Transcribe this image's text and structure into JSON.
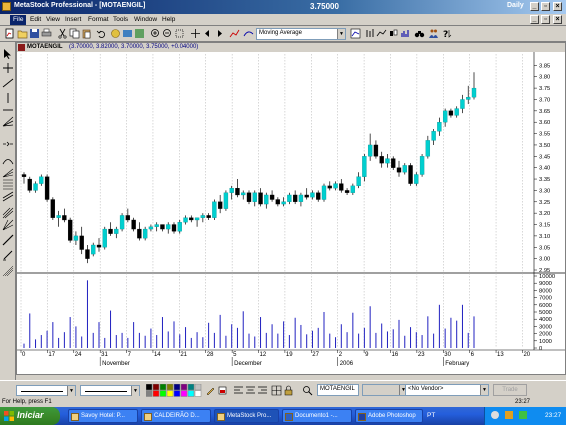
{
  "window": {
    "app_title": "MetaStock Professional - [MOTAENGIL]",
    "center_value": "3.75000",
    "periodicity": "Daily"
  },
  "menu": [
    "File",
    "Edit",
    "View",
    "Insert",
    "Format",
    "Tools",
    "Window",
    "Help"
  ],
  "toolbar": {
    "indicator_select": "Moving Average"
  },
  "chart_header": {
    "symbol": "MOTAENGIL",
    "values": "(3.70000, 3.82000, 3.70000, 3.75000, +0.04000)"
  },
  "chart_data": {
    "type": "candlestick",
    "title": "MOTAENGIL",
    "price_axis": {
      "range": [
        2.95,
        3.9
      ],
      "ticks": [
        "3.85",
        "3.80",
        "3.75",
        "3.70",
        "3.65",
        "3.60",
        "3.55",
        "3.50",
        "3.45",
        "3.40",
        "3.35",
        "3.30",
        "3.25",
        "3.20",
        "3.15",
        "3.10",
        "3.05",
        "3.00",
        "2.95"
      ]
    },
    "volume_axis": {
      "range": [
        0,
        10000
      ],
      "ticks": [
        "10000",
        "9000",
        "8000",
        "7000",
        "6000",
        "5000",
        "4000",
        "3000",
        "2000",
        "1000",
        "0"
      ]
    },
    "x_ticks": [
      "0",
      "17",
      "24",
      "31",
      "7",
      "14",
      "21",
      "28",
      "5",
      "12",
      "19",
      "27",
      "2",
      "9",
      "16",
      "23",
      "30",
      "6",
      "13",
      "20"
    ],
    "month_labels": [
      "November",
      "December",
      "2006",
      "February"
    ],
    "candles": [
      [
        3.37,
        3.38,
        3.33,
        3.36
      ],
      [
        3.35,
        3.36,
        3.29,
        3.3
      ],
      [
        3.3,
        3.34,
        3.29,
        3.33
      ],
      [
        3.33,
        3.37,
        3.32,
        3.36
      ],
      [
        3.36,
        3.37,
        3.25,
        3.26
      ],
      [
        3.26,
        3.27,
        3.17,
        3.18
      ],
      [
        3.18,
        3.21,
        3.14,
        3.19
      ],
      [
        3.19,
        3.22,
        3.16,
        3.17
      ],
      [
        3.17,
        3.18,
        3.07,
        3.08
      ],
      [
        3.08,
        3.12,
        3.06,
        3.1
      ],
      [
        3.1,
        3.14,
        3.02,
        3.04
      ],
      [
        3.04,
        3.06,
        2.98,
        3.0
      ],
      [
        3.02,
        3.07,
        3.01,
        3.06
      ],
      [
        3.06,
        3.09,
        3.03,
        3.05
      ],
      [
        3.05,
        3.14,
        3.04,
        3.13
      ],
      [
        3.13,
        3.16,
        3.1,
        3.11
      ],
      [
        3.11,
        3.14,
        3.09,
        3.13
      ],
      [
        3.13,
        3.2,
        3.12,
        3.19
      ],
      [
        3.19,
        3.22,
        3.16,
        3.17
      ],
      [
        3.17,
        3.18,
        3.12,
        3.13
      ],
      [
        3.13,
        3.16,
        3.08,
        3.09
      ],
      [
        3.09,
        3.14,
        3.08,
        3.13
      ],
      [
        3.13,
        3.15,
        3.12,
        3.14
      ],
      [
        3.14,
        3.16,
        3.12,
        3.15
      ],
      [
        3.15,
        3.15,
        3.12,
        3.13
      ],
      [
        3.13,
        3.16,
        3.11,
        3.15
      ],
      [
        3.15,
        3.16,
        3.11,
        3.12
      ],
      [
        3.12,
        3.17,
        3.11,
        3.16
      ],
      [
        3.16,
        3.19,
        3.15,
        3.18
      ],
      [
        3.18,
        3.19,
        3.16,
        3.17
      ],
      [
        3.17,
        3.18,
        3.14,
        3.18
      ],
      [
        3.18,
        3.2,
        3.16,
        3.19
      ],
      [
        3.19,
        3.2,
        3.17,
        3.18
      ],
      [
        3.18,
        3.26,
        3.17,
        3.25
      ],
      [
        3.25,
        3.28,
        3.2,
        3.22
      ],
      [
        3.22,
        3.3,
        3.21,
        3.29
      ],
      [
        3.29,
        3.32,
        3.26,
        3.31
      ],
      [
        3.31,
        3.35,
        3.27,
        3.28
      ],
      [
        3.28,
        3.3,
        3.26,
        3.29
      ],
      [
        3.29,
        3.3,
        3.24,
        3.25
      ],
      [
        3.25,
        3.3,
        3.23,
        3.29
      ],
      [
        3.29,
        3.31,
        3.23,
        3.24
      ],
      [
        3.24,
        3.29,
        3.22,
        3.28
      ],
      [
        3.28,
        3.3,
        3.25,
        3.26
      ],
      [
        3.26,
        3.27,
        3.23,
        3.24
      ],
      [
        3.24,
        3.27,
        3.23,
        3.25
      ],
      [
        3.25,
        3.29,
        3.24,
        3.28
      ],
      [
        3.28,
        3.3,
        3.24,
        3.25
      ],
      [
        3.25,
        3.29,
        3.23,
        3.28
      ],
      [
        3.28,
        3.31,
        3.26,
        3.27
      ],
      [
        3.27,
        3.3,
        3.26,
        3.29
      ],
      [
        3.29,
        3.3,
        3.25,
        3.26
      ],
      [
        3.26,
        3.33,
        3.25,
        3.32
      ],
      [
        3.32,
        3.34,
        3.3,
        3.31
      ],
      [
        3.31,
        3.34,
        3.3,
        3.33
      ],
      [
        3.33,
        3.35,
        3.29,
        3.3
      ],
      [
        3.3,
        3.31,
        3.28,
        3.29
      ],
      [
        3.29,
        3.33,
        3.28,
        3.32
      ],
      [
        3.32,
        3.38,
        3.31,
        3.36
      ],
      [
        3.36,
        3.46,
        3.34,
        3.45
      ],
      [
        3.45,
        3.55,
        3.43,
        3.5
      ],
      [
        3.5,
        3.52,
        3.44,
        3.45
      ],
      [
        3.45,
        3.47,
        3.4,
        3.42
      ],
      [
        3.42,
        3.46,
        3.4,
        3.44
      ],
      [
        3.44,
        3.45,
        3.39,
        3.4
      ],
      [
        3.4,
        3.43,
        3.36,
        3.38
      ],
      [
        3.38,
        3.42,
        3.37,
        3.41
      ],
      [
        3.41,
        3.42,
        3.32,
        3.33
      ],
      [
        3.33,
        3.38,
        3.32,
        3.37
      ],
      [
        3.37,
        3.46,
        3.36,
        3.45
      ],
      [
        3.45,
        3.54,
        3.44,
        3.52
      ],
      [
        3.52,
        3.57,
        3.5,
        3.56
      ],
      [
        3.56,
        3.62,
        3.54,
        3.6
      ],
      [
        3.6,
        3.66,
        3.58,
        3.65
      ],
      [
        3.65,
        3.66,
        3.62,
        3.63
      ],
      [
        3.63,
        3.67,
        3.62,
        3.66
      ],
      [
        3.66,
        3.72,
        3.64,
        3.7
      ],
      [
        3.7,
        3.76,
        3.68,
        3.71
      ],
      [
        3.71,
        3.82,
        3.7,
        3.75
      ]
    ],
    "volume": [
      600,
      4800,
      1200,
      1800,
      2400,
      3600,
      1400,
      2200,
      4300,
      3000,
      1600,
      9400,
      2100,
      3600,
      1400,
      5200,
      1800,
      2100,
      1400,
      3600,
      2100,
      1700,
      2700,
      1800,
      4300,
      2300,
      3700,
      1900,
      2900,
      1400,
      2200,
      1500,
      3500,
      2100,
      4600,
      1700,
      3300,
      2800,
      5100,
      2000,
      1600,
      4300,
      2100,
      3300,
      2000,
      3700,
      1800,
      4200,
      3200,
      1900,
      2400,
      2800,
      5000,
      2000,
      1500,
      3300,
      2200,
      4900,
      2000,
      2800,
      5800,
      2100,
      3400,
      2300,
      2600,
      3900,
      1700,
      2900,
      2200,
      1800,
      4400,
      2000,
      6000,
      2700,
      4200,
      3800,
      6000,
      2100,
      4400
    ]
  },
  "bottom": {
    "symbol_value": "MOTAENGIL",
    "vendor_value": "<No Vendor>",
    "trade_label": "Trade"
  },
  "status": {
    "help_text": "For Help, press F1",
    "time": "23:27"
  },
  "taskbar": {
    "start_label": "Iniciar",
    "tasks": [
      "Savoy Hotel: P...",
      "CALDEIRÃO D...",
      "MetaStock Pro...",
      "Documento1 -...",
      "Adobe Photoshop"
    ],
    "lang": "PT",
    "clock": "23:27"
  },
  "colors": {
    "up_candle": "#00cfcf",
    "down_candle": "#000000",
    "volume_bar": "#2020c0",
    "axis_text": "#000000",
    "grid": "#b0b0b0"
  }
}
